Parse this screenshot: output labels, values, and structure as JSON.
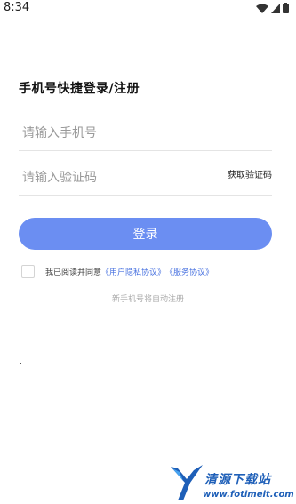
{
  "status_bar": {
    "time": "8:34",
    "icons": [
      "wifi-icon",
      "signal-icon",
      "battery-icon"
    ]
  },
  "login": {
    "title": "手机号快捷登录/注册",
    "phone_placeholder": "请输入手机号",
    "code_placeholder": "请输入验证码",
    "get_code_label": "获取验证码",
    "login_button_label": "登录",
    "agreement": {
      "prefix": "我已阅读并同意",
      "privacy_link": "《用户隐私协议》",
      "service_link": "《服务协议》"
    },
    "auto_register_note": "新手机号将自动注册"
  },
  "watermark": {
    "title": "清源下载站",
    "url": "www.fotimeit.com"
  },
  "colors": {
    "accent": "#6b8ef2",
    "link": "#4a73e0",
    "watermark": "#1e5fb8"
  }
}
